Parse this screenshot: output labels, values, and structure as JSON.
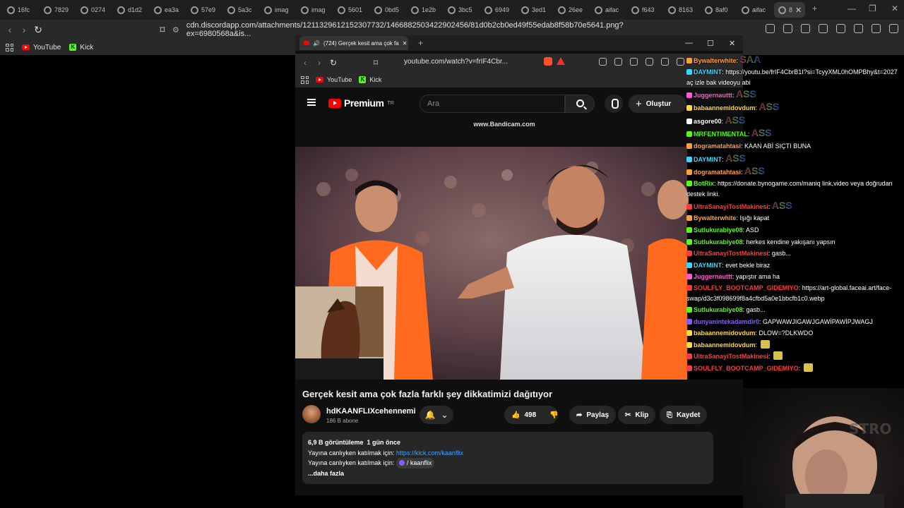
{
  "outer_browser": {
    "tabs": [
      "16fc",
      "7829",
      "0274",
      "d1d2",
      "ea3a",
      "57e9",
      "5a3c",
      "imag",
      "imag",
      "5601",
      "0bd5",
      "1e2b",
      "3bc5",
      "6949",
      "3ed1",
      "26ee",
      "aifac",
      "f643",
      "8163",
      "8af0",
      "aifac",
      "8"
    ],
    "url": "cdn.discordapp.com/attachments/1211329612152307732/1466882503422902456/81d0b2cb0ed49f55edab8f58b70e5641.png?ex=6980568a&is...",
    "bookmarks": [
      {
        "label": "YouTube"
      },
      {
        "label": "Kick"
      }
    ]
  },
  "inner_browser": {
    "tab_title": "(724) Gerçek kesit ama çok fa",
    "url": "youtube.com/watch?v=frIF4Cbr...",
    "bookmarks": [
      {
        "label": "YouTube"
      },
      {
        "label": "Kick"
      }
    ]
  },
  "youtube": {
    "logo_text": "Premium",
    "region": "TR",
    "search_placeholder": "Ara",
    "create_label": "Oluştur",
    "watermark": "www.Bandicam.com",
    "video_title": "Gerçek kesit ama çok fazla farklı şey dikkatimizi dağıtıyor",
    "channel_name": "hdKAANFLIXcehennemi",
    "subscribers": "186 B abone",
    "like_count": "498",
    "share_label": "Paylaş",
    "clip_label": "Klip",
    "save_label": "Kaydet",
    "description": {
      "views": "6,9 B görüntüleme",
      "age": "1 gün önce",
      "line1_prefix": "Yayına canlıyken katılmak için:",
      "line1_link": "https://kick.com/kaanflix",
      "line2_prefix": "Yayına canlıyken katılmak için:",
      "line2_badge": "/ kaanflix",
      "more": "...daha fazla"
    }
  },
  "chat": [
    {
      "user": "Bywalterwhite",
      "color": "#ff9f3a",
      "text": "",
      "ass": "SAA"
    },
    {
      "user": "DAYMINT",
      "color": "#3ad6ff",
      "text": "https://youtu.be/frIF4CbrB1I?si=TcyyXML0hOMPBhy&t=2027 aç izle bak videoyu abi",
      "wrap": true
    },
    {
      "user": "Juggernauttt",
      "color": "#ff5ad2",
      "text": "",
      "ass": "ASS"
    },
    {
      "user": "babaannemidovdum",
      "color": "#ffd83a",
      "text": "",
      "ass": "ASS"
    },
    {
      "user": "asgore00",
      "color": "#ffffff",
      "text": "",
      "ass": "ASS"
    },
    {
      "user": "MRFENTIMENTAL",
      "color": "#53fc18",
      "text": "",
      "ass": "ASS"
    },
    {
      "user": "dogramatahtasi",
      "color": "#ff9f3a",
      "text": "KAAN ABİ SIÇTI BUNA"
    },
    {
      "user": "DAYMINT",
      "color": "#3ad6ff",
      "text": "",
      "ass": "ASS"
    },
    {
      "user": "dogramatahtasi",
      "color": "#ff9f3a",
      "text": "",
      "ass": "ASS"
    },
    {
      "user": "BotRix",
      "color": "#53fc18",
      "text": "https://donate.bynogame.com/maniq link,video veya doğrudan destek linki.",
      "wrap": true
    },
    {
      "user": "UltraSanayiTostMakinesi",
      "color": "#ff3a3a",
      "text": "",
      "ass": "ASS"
    },
    {
      "user": "Bywalterwhite",
      "color": "#ff9f3a",
      "text": "Işığı kapat"
    },
    {
      "user": "Sutlukurabiye08",
      "color": "#53fc18",
      "text": "ASD"
    },
    {
      "user": "Sutlukurabiye08",
      "color": "#53fc18",
      "text": "herkes kendine yakışanı yapsın"
    },
    {
      "user": "UltraSanayiTostMakinesi",
      "color": "#ff3a3a",
      "text": "gasb..."
    },
    {
      "user": "DAYMINT",
      "color": "#3ad6ff",
      "text": "evet bekle biraz"
    },
    {
      "user": "Juggernauttt",
      "color": "#ff5ad2",
      "text": "yapıştır ama ha"
    },
    {
      "user": "SOULFLY_BOOTCAMP_GIDEMIYO",
      "color": "#ff3a3a",
      "text": "https://art-global.faceai.art/face-swap/d3c3f098699f8a4cfbd5a0e1bbcfb1c0.webp",
      "wrap": true
    },
    {
      "user": "Sutlukurabiye08",
      "color": "#53fc18",
      "text": "gasb..."
    },
    {
      "user": "dunyanintekadamdir0",
      "color": "#8a5cf6",
      "text": "GAPWAWJIGAWJGAWİPAWİPJWAGJ"
    },
    {
      "user": "babaannemidovdum",
      "color": "#ffd83a",
      "text": "DLOW=?DLKWDO"
    },
    {
      "user": "babaannemidovdum",
      "color": "#ffd83a",
      "text": ""
    },
    {
      "user": "UltraSanayiTostMakinesi",
      "color": "#ff3a3a",
      "text": ""
    },
    {
      "user": "SOULFLY_BOOTCAMP_GIDEMIYO",
      "color": "#ff3a3a",
      "text": ""
    }
  ]
}
